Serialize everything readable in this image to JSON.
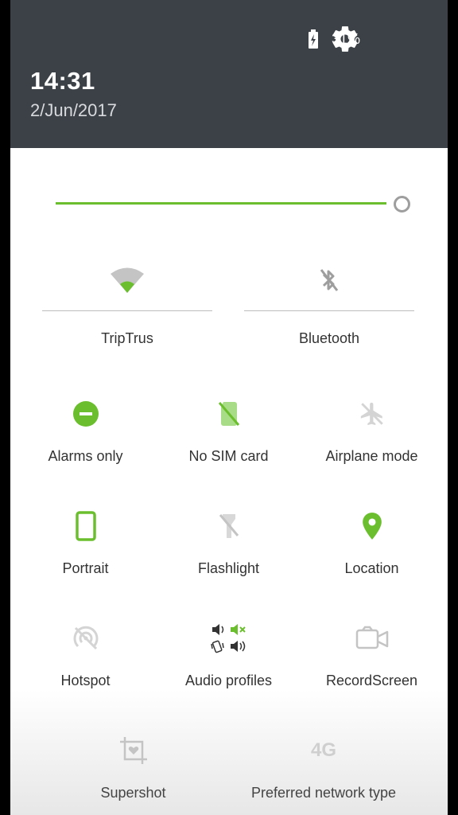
{
  "status": {
    "battery": "31%"
  },
  "clock": {
    "time": "14:31",
    "date": "2/Jun/2017"
  },
  "brightness": {
    "level": 0.97
  },
  "big_tiles": [
    {
      "label": "TripTrus",
      "icon": "wifi-icon"
    },
    {
      "label": "Bluetooth",
      "icon": "bluetooth-off-icon"
    }
  ],
  "tiles": [
    {
      "label": "Alarms only",
      "icon": "do-not-disturb-icon"
    },
    {
      "label": "No SIM card",
      "icon": "no-sim-icon"
    },
    {
      "label": "Airplane mode",
      "icon": "airplane-icon"
    },
    {
      "label": "Portrait",
      "icon": "portrait-icon"
    },
    {
      "label": "Flashlight",
      "icon": "flashlight-off-icon"
    },
    {
      "label": "Location",
      "icon": "location-pin-icon"
    },
    {
      "label": "Hotspot",
      "icon": "hotspot-off-icon"
    },
    {
      "label": "Audio profiles",
      "icon": "audio-profiles-icon"
    },
    {
      "label": "RecordScreen",
      "icon": "record-screen-icon"
    },
    {
      "label": "Supershot",
      "icon": "supershot-icon"
    },
    {
      "label": "Preferred network type",
      "icon": "network-4g-icon",
      "icon_text": "4G"
    }
  ],
  "colors": {
    "header": "#3b4147",
    "accent": "#6bbf2e",
    "inactive_icon": "#c4c4c4"
  }
}
